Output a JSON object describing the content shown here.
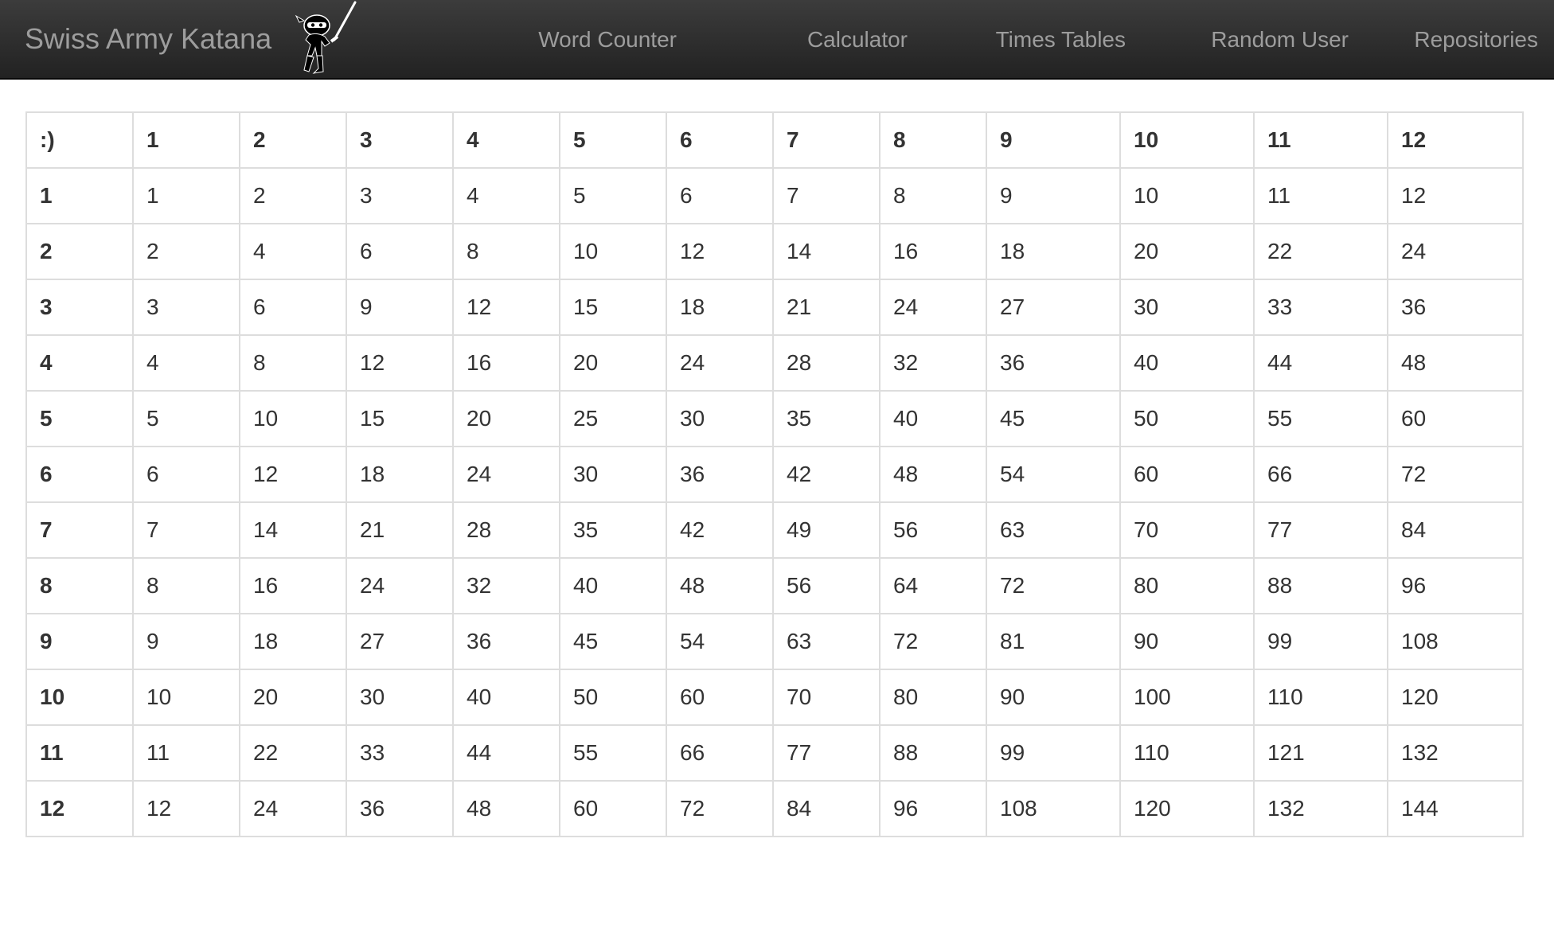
{
  "navbar": {
    "brand": "Swiss Army Katana",
    "links": [
      {
        "label": "Word Counter"
      },
      {
        "label": "Calculator"
      },
      {
        "label": "Times Tables"
      },
      {
        "label": "Random User"
      },
      {
        "label": "Repositories"
      }
    ]
  },
  "table": {
    "corner": ":)",
    "columns": [
      "1",
      "2",
      "3",
      "4",
      "5",
      "6",
      "7",
      "8",
      "9",
      "10",
      "11",
      "12"
    ],
    "rows": [
      {
        "label": "1",
        "cells": [
          "1",
          "2",
          "3",
          "4",
          "5",
          "6",
          "7",
          "8",
          "9",
          "10",
          "11",
          "12"
        ]
      },
      {
        "label": "2",
        "cells": [
          "2",
          "4",
          "6",
          "8",
          "10",
          "12",
          "14",
          "16",
          "18",
          "20",
          "22",
          "24"
        ]
      },
      {
        "label": "3",
        "cells": [
          "3",
          "6",
          "9",
          "12",
          "15",
          "18",
          "21",
          "24",
          "27",
          "30",
          "33",
          "36"
        ]
      },
      {
        "label": "4",
        "cells": [
          "4",
          "8",
          "12",
          "16",
          "20",
          "24",
          "28",
          "32",
          "36",
          "40",
          "44",
          "48"
        ]
      },
      {
        "label": "5",
        "cells": [
          "5",
          "10",
          "15",
          "20",
          "25",
          "30",
          "35",
          "40",
          "45",
          "50",
          "55",
          "60"
        ]
      },
      {
        "label": "6",
        "cells": [
          "6",
          "12",
          "18",
          "24",
          "30",
          "36",
          "42",
          "48",
          "54",
          "60",
          "66",
          "72"
        ]
      },
      {
        "label": "7",
        "cells": [
          "7",
          "14",
          "21",
          "28",
          "35",
          "42",
          "49",
          "56",
          "63",
          "70",
          "77",
          "84"
        ]
      },
      {
        "label": "8",
        "cells": [
          "8",
          "16",
          "24",
          "32",
          "40",
          "48",
          "56",
          "64",
          "72",
          "80",
          "88",
          "96"
        ]
      },
      {
        "label": "9",
        "cells": [
          "9",
          "18",
          "27",
          "36",
          "45",
          "54",
          "63",
          "72",
          "81",
          "90",
          "99",
          "108"
        ]
      },
      {
        "label": "10",
        "cells": [
          "10",
          "20",
          "30",
          "40",
          "50",
          "60",
          "70",
          "80",
          "90",
          "100",
          "110",
          "120"
        ]
      },
      {
        "label": "11",
        "cells": [
          "11",
          "22",
          "33",
          "44",
          "55",
          "66",
          "77",
          "88",
          "99",
          "110",
          "121",
          "132"
        ]
      },
      {
        "label": "12",
        "cells": [
          "12",
          "24",
          "36",
          "48",
          "60",
          "72",
          "84",
          "96",
          "108",
          "120",
          "132",
          "144"
        ]
      }
    ]
  }
}
